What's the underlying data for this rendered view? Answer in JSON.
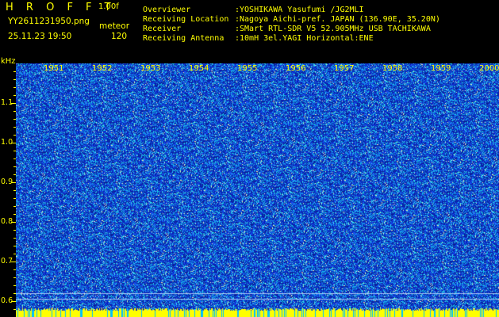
{
  "header": {
    "app_title": "H R O F F T",
    "version": "1.00f",
    "filename": "YY2611231950.png",
    "mode": "meteor",
    "datetime": "25.11.23 19:50",
    "count": "120",
    "labels": {
      "overviewer": "Overviewer",
      "location": "Receiving Location",
      "receiver": "Receiver",
      "antenna": "Receiving Antenna"
    },
    "values": {
      "overviewer": ":YOSHIKAWA Yasufumi /JG2MLI",
      "location": ":Nagoya Aichi-pref. JAPAN (136.90E, 35.20N)",
      "receiver": ":SMart RTL-SDR V5 52.905MHz USB TACHIKAWA",
      "antenna": ":10mH 3el.YAGI Horizontal:ENE"
    }
  },
  "axis": {
    "y_unit": "kHz",
    "y_ticks": [
      "1.1",
      "1.0",
      "0.9",
      "0.8",
      "0.7",
      "0.6"
    ],
    "x_ticks": [
      "1951",
      "1952",
      "1953",
      "1954",
      "1955",
      "1956",
      "1957",
      "1958",
      "1959",
      "2000"
    ]
  },
  "colors": {
    "background": "#000000",
    "text": "#ffff00",
    "white_text": "#ffffff",
    "waterfall_base": "#1a2fd0"
  }
}
